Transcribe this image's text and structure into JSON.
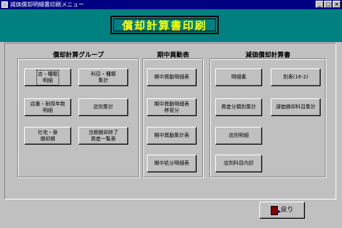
{
  "window": {
    "title": "減価償却明細書印刷メニュー"
  },
  "banner": {
    "title": "償却計算書印刷"
  },
  "groups": {
    "group1": {
      "heading": "償却計算グループ",
      "buttons": [
        "店・種類\n明細",
        "科目・種類\n集計",
        "店番・耐用年数\n明細",
        "店別集計",
        "社宅・寮\n償却額",
        "当期償却終了\n資産一覧表"
      ]
    },
    "group2": {
      "heading": "期中異動表",
      "buttons": [
        "期中異動明細表",
        "期中異動明細表\n移管分",
        "期中異動集計表",
        "期中処分明細表"
      ]
    },
    "group3": {
      "heading": "減価償却計算書",
      "buttons": [
        "明細書",
        "別表(16-2)",
        "資産分類別集計",
        "減価償却科目集計",
        "店別明細",
        "店別科目内訳"
      ]
    }
  },
  "footer": {
    "back_label": "戻り"
  }
}
